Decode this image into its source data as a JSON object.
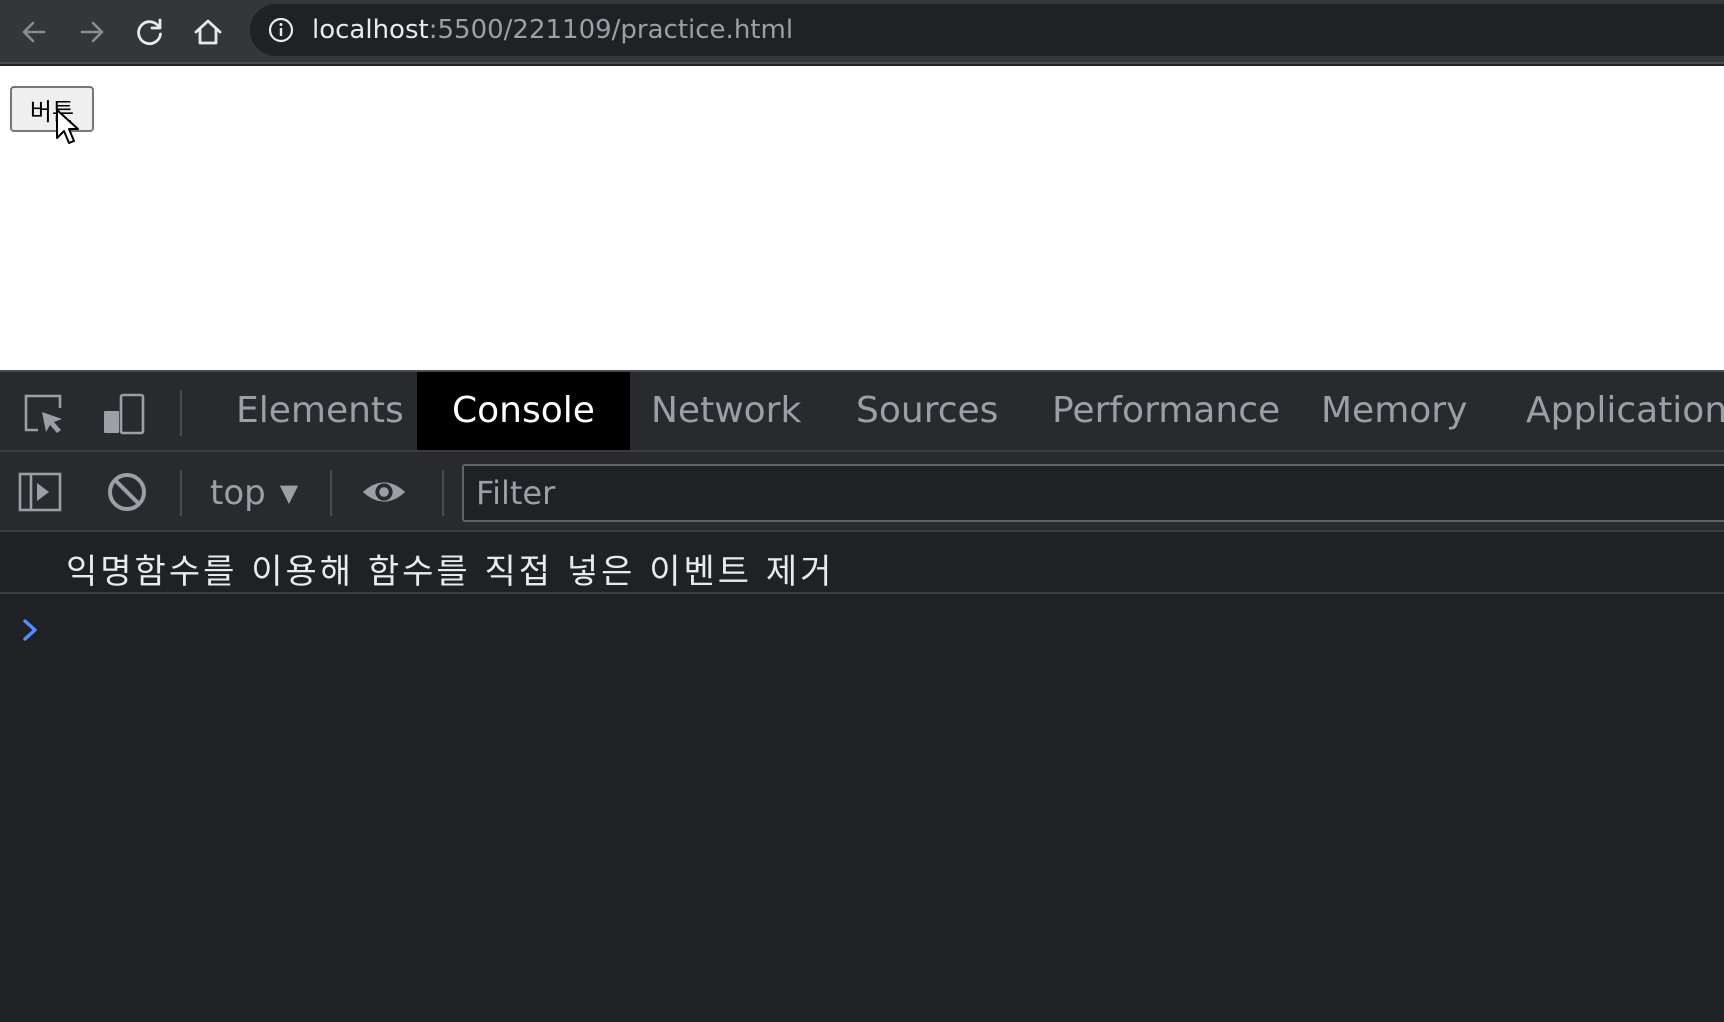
{
  "browser": {
    "url_host": "localhost",
    "url_path": ":5500/221109/practice.html",
    "icons": [
      "back-arrow-icon",
      "forward-arrow-icon",
      "reload-icon",
      "home-icon",
      "info-icon"
    ]
  },
  "page": {
    "button_label": "버튼"
  },
  "devtools": {
    "tabs": [
      "Elements",
      "Console",
      "Network",
      "Sources",
      "Performance",
      "Memory",
      "Application"
    ],
    "active_tab": "Console",
    "context": "top",
    "filter_placeholder": "Filter",
    "log_messages": [
      "익명함수를 이용해 함수를 직접 넣은 이벤트 제거"
    ],
    "prompt_color": "#4d90fe"
  }
}
